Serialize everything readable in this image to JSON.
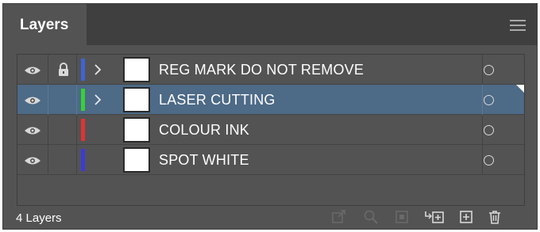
{
  "panel": {
    "tab_label": "Layers",
    "menu_icon": "hamburger-menu-icon"
  },
  "layers": [
    {
      "name": "REG MARK DO NOT REMOVE",
      "visible": true,
      "locked": true,
      "expandable": true,
      "color": "#3f63d6",
      "selected": false
    },
    {
      "name": "LASER CUTTING",
      "visible": true,
      "locked": false,
      "expandable": true,
      "color": "#35d235",
      "selected": true
    },
    {
      "name": "COLOUR INK",
      "visible": true,
      "locked": false,
      "expandable": false,
      "color": "#e13232",
      "selected": false
    },
    {
      "name": "SPOT WHITE",
      "visible": true,
      "locked": false,
      "expandable": false,
      "color": "#3b3bd8",
      "selected": false
    }
  ],
  "footer": {
    "count_label": "4 Layers",
    "buttons": [
      {
        "name": "export-icon",
        "enabled": false
      },
      {
        "name": "locate-object-icon",
        "enabled": false
      },
      {
        "name": "clipping-mask-icon",
        "enabled": false
      },
      {
        "name": "new-sublayer-icon",
        "enabled": true
      },
      {
        "name": "new-layer-icon",
        "enabled": true
      },
      {
        "name": "trash-icon",
        "enabled": true
      }
    ]
  },
  "colors": {
    "panel_bg": "#535353",
    "tabbar_bg": "#3f3f3f",
    "selection": "#4d6a87"
  }
}
